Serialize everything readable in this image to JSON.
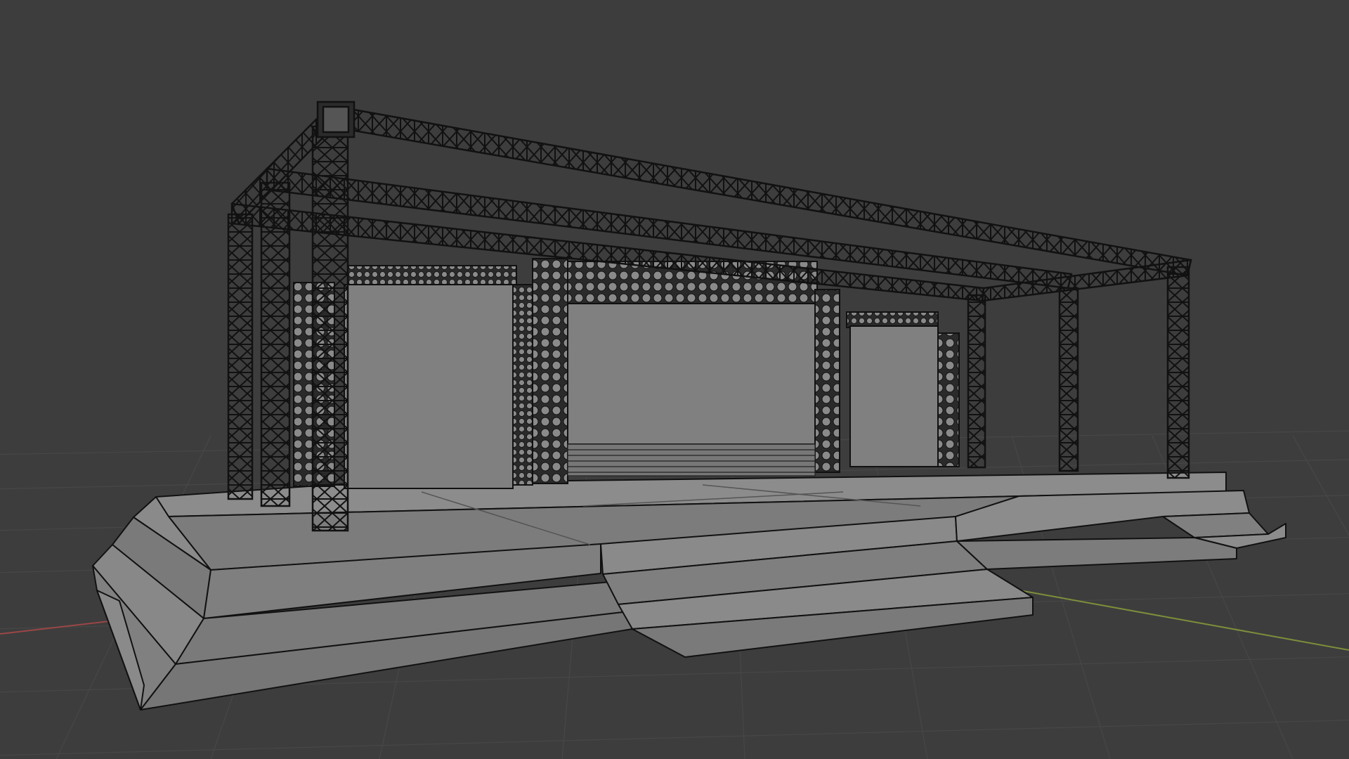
{
  "viewport": {
    "background_color": "#3d3d3d",
    "grid_color": "#474747",
    "x_axis_color": "#9b4646",
    "y_axis_color": "#7d8f3b",
    "wire_color": "#111111",
    "mesh_side_color": "#7a7a7a",
    "mesh_top_color": "#8c8c8c",
    "screen_color": "#808080",
    "led_panel_color": "#2a2a2a",
    "led_dot_color": "#8a8a8a"
  },
  "scene": {
    "object": "stage-model",
    "shading": "wireframe-overlay",
    "icons": [
      "grid-floor",
      "x-axis-line",
      "y-axis-line"
    ]
  }
}
